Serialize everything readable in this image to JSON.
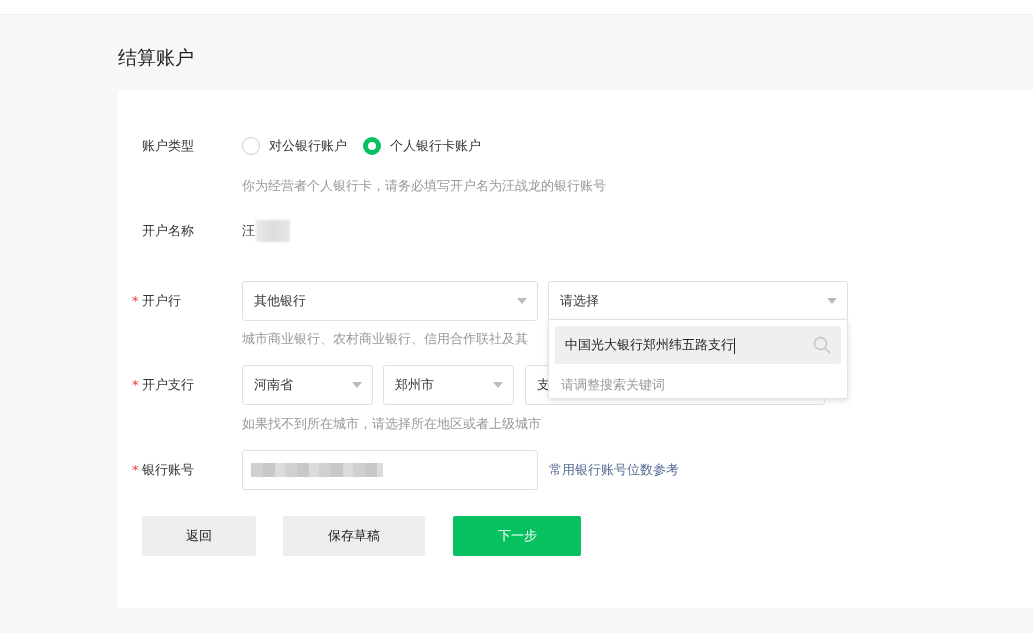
{
  "page_title": "结算账户",
  "account_type": {
    "label": "账户类型",
    "options": [
      {
        "label": "对公银行账户",
        "selected": false
      },
      {
        "label": "个人银行卡账户",
        "selected": true
      }
    ],
    "hint": "你为经营者个人银行卡，请务必填写开户名为汪战龙的银行账号"
  },
  "account_name": {
    "label": "开户名称",
    "value": "汪"
  },
  "bank": {
    "label": "开户行",
    "required_mark": "*",
    "select_value": "其他银行",
    "branch_placeholder": "请选择",
    "hint": "城市商业银行、农村商业银行、信用合作联社及其",
    "dropdown": {
      "expanded": true,
      "search_value": "中国光大银行郑州纬五路支行",
      "message": "请调整搜索关键词"
    }
  },
  "branch": {
    "label": "开户支行",
    "required_mark": "*",
    "province": "河南省",
    "city": "郑州市",
    "branch_value": "支",
    "hint": "如果找不到所在城市，请选择所在地区或者上级城市"
  },
  "account_number": {
    "label": "银行账号",
    "required_mark": "*",
    "link": "常用银行账号位数参考"
  },
  "buttons": [
    {
      "label": "返回",
      "kind": "secondary"
    },
    {
      "label": "保存草稿",
      "kind": "secondary"
    },
    {
      "label": "下一步",
      "kind": "primary"
    }
  ]
}
